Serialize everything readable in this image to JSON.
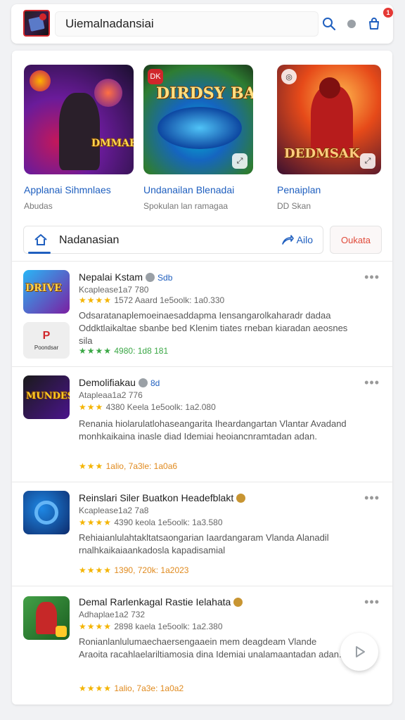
{
  "header": {
    "search_value": "Uiemalnadansiai",
    "badge_count": "1",
    "icons": [
      "search-icon",
      "dot-icon",
      "bag-icon"
    ]
  },
  "featured": [
    {
      "title": "Applanai Sihmnlaes",
      "subtitle": "Abudas",
      "art_text": "DMMAE MIMIES",
      "badge": ""
    },
    {
      "title": "Undanailan Blenadai",
      "subtitle": "Spokulan lan ramagaa",
      "art_text": "DIRDSY BAUSNERR",
      "badge": "DK"
    },
    {
      "title": "Penaiplan",
      "subtitle": "DD Skan",
      "art_text": "DEDMSAK",
      "badge": ""
    }
  ],
  "tabs": {
    "label": "Nadanasian",
    "share_label": "Ailo",
    "action_label": "Oukata"
  },
  "apps": [
    {
      "name": "Nepalai Kstam",
      "name_num": "Sdb",
      "sub": "Kcaplease1a7 780",
      "rating_stars": "★★★★",
      "rating_text": "1572 Aaard 1e5oolk: 1a0.330",
      "desc": "Odsaratanaplemoeinaesaddapma Iensangarolkaharadr dadaa Oddktlaikaltae sbanbe bed Klenim tiates rneban kiaradan aeosnes sila",
      "foot_stars": "★★★★",
      "foot_text": "4980: 1d8 181",
      "foot_color": "#3aa745",
      "sub_icon_label": "Poondsar",
      "sub_icon_mark": "P"
    },
    {
      "name": "Demolifiakau",
      "name_num": "8d",
      "sub": "Atapleaa1a2 776",
      "rating_stars": "★★★",
      "rating_text": "4380 Keela 1e5oolk: 1a2.080",
      "desc": "Renania hiolarulatlohaseangarita Iheardangartan Vlantar Avadand monhkaikaina inasle diad Idemiai heoiancnramtadan adan.",
      "foot_stars": "★★★",
      "foot_text": "1alio, 7a3le: 1a0a6",
      "foot_color": "#e08a1e"
    },
    {
      "name": "Reinslari Siler Buatkon Headefblakt",
      "name_num": "",
      "sub": "Kcaplease1a2 7a8",
      "rating_stars": "★★★★",
      "rating_text": "4390 keola 1e5oolk: 1a3.580",
      "desc": "Rehiaianlulahtakltatsaongarian Iaardangaram Vlanda Alanadil rnalhkaikaiaankadosla kapadisamial",
      "foot_stars": "★★★★",
      "foot_text": "1390, 720k: 1a2023",
      "foot_color": "#e08a1e"
    },
    {
      "name": "Demal Rarlenkagal Rastie Ielahata",
      "name_num": "",
      "sub": "Adhaplae1a2 732",
      "rating_stars": "★★★★",
      "rating_text": "2898 kaela 1e5oolk: 1a2.380",
      "desc": "Ronianlanlulumaechaersengaaein mem deagdeam Vlande Araoita racahlaelariltiamosia dina Idemiai unalamaantadan adan.",
      "foot_stars": "★★★★",
      "foot_text": "1alio, 7a3e: 1a0a2",
      "foot_color": "#e08a1e"
    }
  ],
  "colors": {
    "accent": "#1f5fbf",
    "star": "#f4b400",
    "alert": "#e04a3a"
  }
}
